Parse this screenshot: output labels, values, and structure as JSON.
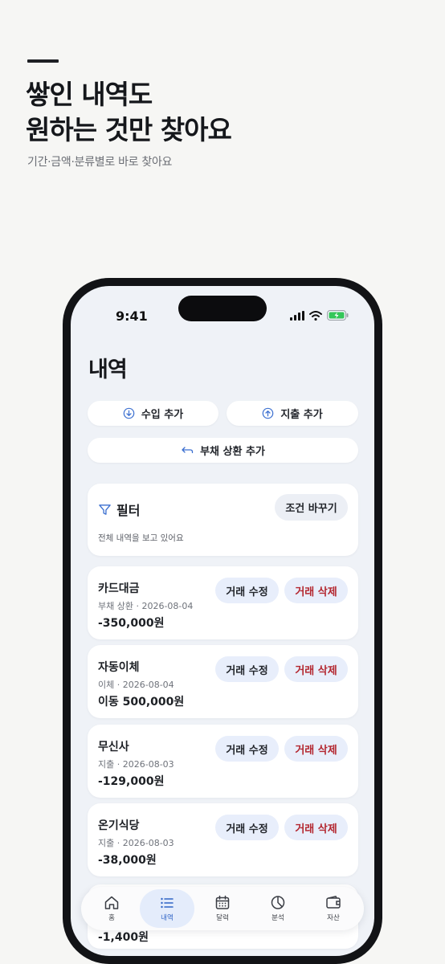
{
  "promo": {
    "title_line1": "쌓인 내역도",
    "title_line2": "원하는 것만 찾아요",
    "subtitle": "기간·금액·분류별로 바로 찾아요"
  },
  "status_bar": {
    "time": "9:41"
  },
  "page": {
    "title": "내역"
  },
  "actions": {
    "income_label": "수입 추가",
    "expense_label": "지출 추가",
    "debt_label": "부채 상환 추가"
  },
  "filter": {
    "title": "필터",
    "change_button": "조건 바꾸기",
    "description": "전체 내역을 보고 있어요"
  },
  "transactions": [
    {
      "name": "카드대금",
      "meta": "부채 상환 · 2026-08-04",
      "amount": "-350,000원",
      "edit": "거래 수정",
      "delete": "거래 삭제"
    },
    {
      "name": "자동이체",
      "meta": "이체 · 2026-08-04",
      "amount": "이동 500,000원",
      "edit": "거래 수정",
      "delete": "거래 삭제"
    },
    {
      "name": "무신사",
      "meta": "지출 · 2026-08-03",
      "amount": "-129,000원",
      "edit": "거래 수정",
      "delete": "거래 삭제"
    },
    {
      "name": "온기식당",
      "meta": "지출 · 2026-08-03",
      "amount": "-38,000원",
      "edit": "거래 수정",
      "delete": "거래 삭제"
    }
  ],
  "partial_transaction": {
    "amount": "-1,400원"
  },
  "tabbar": {
    "active": "내역",
    "items": [
      {
        "label": "홈",
        "icon": "home-icon"
      },
      {
        "label": "내역",
        "icon": "list-icon"
      },
      {
        "label": "달력",
        "icon": "calendar-icon"
      },
      {
        "label": "분석",
        "icon": "pie-chart-icon"
      },
      {
        "label": "자산",
        "icon": "wallet-icon"
      }
    ]
  },
  "colors": {
    "accent": "#2f64c6",
    "danger": "#b3262f",
    "screen_bg": "#eff2f7",
    "page_bg": "#f6f6f4"
  }
}
